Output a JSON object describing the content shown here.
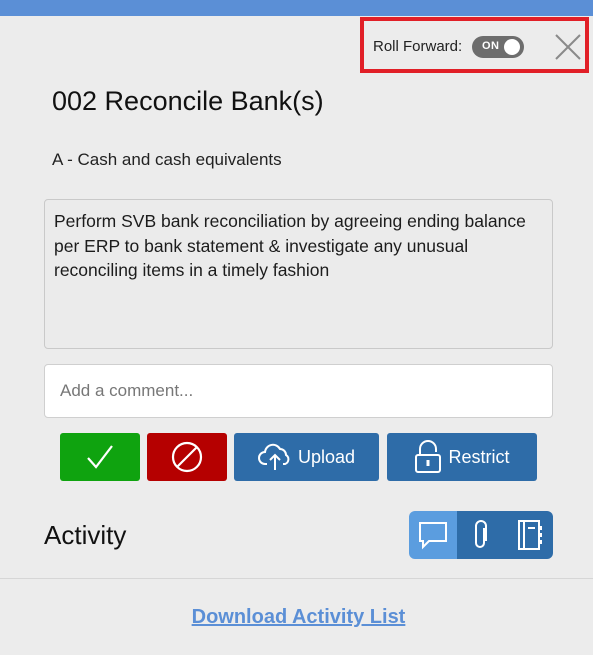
{
  "header": {
    "roll_forward_label": "Roll Forward:",
    "toggle_state": "ON",
    "close_icon": "close-icon"
  },
  "task": {
    "title": "002 Reconcile Bank(s)",
    "category": "A - Cash and cash equivalents",
    "description": "Perform SVB bank reconciliation by agreeing ending balance per ERP to bank statement & investigate any unusual reconciling items in a timely fashion"
  },
  "comment": {
    "placeholder": "Add a comment...",
    "value": ""
  },
  "actions": {
    "approve_icon": "checkmark-icon",
    "reject_icon": "prohibited-icon",
    "upload_label": "Upload",
    "upload_icon": "cloud-upload-icon",
    "restrict_label": "Restrict",
    "restrict_icon": "unlock-icon"
  },
  "activity": {
    "title": "Activity",
    "tabs": [
      "comment-icon",
      "paperclip-icon",
      "notebook-icon"
    ],
    "active_tab": "comment-icon"
  },
  "footer": {
    "download_label": "Download Activity List"
  },
  "colors": {
    "top_bar": "#5b8fd6",
    "approve": "#0fa30f",
    "reject": "#b50000",
    "primary": "#2e6ca8",
    "active_tab": "#5b9ddf",
    "highlight": "#e11f27"
  }
}
